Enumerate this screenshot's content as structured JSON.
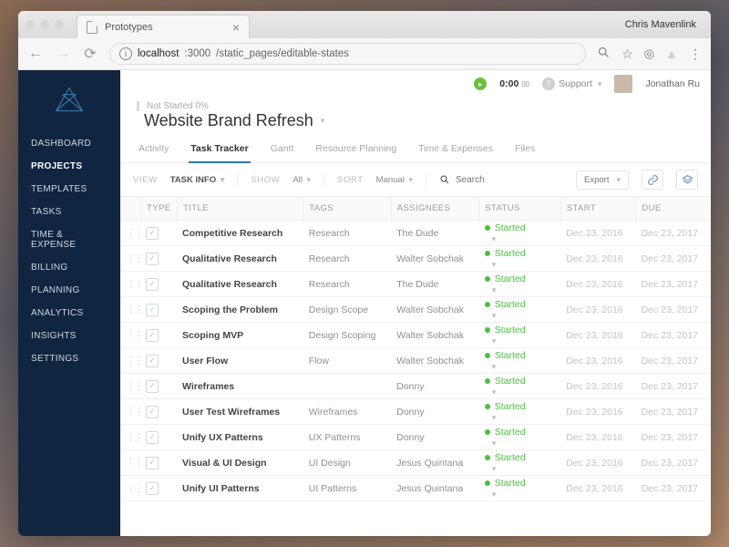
{
  "browser": {
    "tab_title": "Prototypes",
    "user_name": "Chris Mavenlink",
    "url_prefix": "localhost",
    "url_port": ":3000",
    "url_path": "/static_pages/editable-states"
  },
  "header": {
    "timer": "0:00",
    "timer_ms": "00",
    "support": "Support",
    "account_name": "Jonathan Ru"
  },
  "sidebar": {
    "items": [
      "DASHBOARD",
      "PROJECTS",
      "TEMPLATES",
      "TASKS",
      "TIME & EXPENSE",
      "BILLING",
      "PLANNING",
      "ANALYTICS",
      "INSIGHTS",
      "SETTINGS"
    ],
    "active_index": 1
  },
  "project": {
    "status": "Not Started 0%",
    "title": "Website Brand Refresh"
  },
  "tabs": {
    "items": [
      "Activity",
      "Task Tracker",
      "Gantt",
      "Resource Planning",
      "Time & Expenses",
      "Files"
    ],
    "active_index": 1
  },
  "toolbar": {
    "view_label": "VIEW",
    "view_value": "TASK INFO",
    "show_label": "SHOW",
    "show_value": "All",
    "sort_label": "SORT",
    "sort_value": "Manual",
    "search_placeholder": "Search",
    "export": "Export"
  },
  "columns": [
    "TYPE",
    "TITLE",
    "TAGS",
    "ASSIGNEES",
    "STATUS",
    "START",
    "DUE"
  ],
  "rows": [
    {
      "title": "Competitive Research",
      "tag": "Research",
      "assignee": "The Dude",
      "status": "Started",
      "start": "Dec 23, 2016",
      "due": "Dec 23, 2017"
    },
    {
      "title": "Qualitative Research",
      "tag": "Research",
      "assignee": "Walter Sobchak",
      "status": "Started",
      "start": "Dec 23, 2016",
      "due": "Dec 23, 2017"
    },
    {
      "title": "Qualitative Research",
      "tag": "Research",
      "assignee": "The Dude",
      "status": "Started",
      "start": "Dec 23, 2016",
      "due": "Dec 23, 2017"
    },
    {
      "title": "Scoping the Problem",
      "tag": "Design Scope",
      "assignee": "Walter Sobchak",
      "status": "Started",
      "start": "Dec 23, 2016",
      "due": "Dec 23, 2017"
    },
    {
      "title": "Scoping MVP",
      "tag": "Design Scoping",
      "assignee": "Walter Sobchak",
      "status": "Started",
      "start": "Dec 23, 2016",
      "due": "Dec 23, 2017"
    },
    {
      "title": "User Flow",
      "tag": "Flow",
      "assignee": "Walter Sobchak",
      "status": "Started",
      "start": "Dec 23, 2016",
      "due": "Dec 23, 2017"
    },
    {
      "title": "Wireframes",
      "tag": "",
      "assignee": "Donny",
      "status": "Started",
      "start": "Dec 23, 2016",
      "due": "Dec 23, 2017"
    },
    {
      "title": "User Test Wireframes",
      "tag": "Wireframes",
      "assignee": "Donny",
      "status": "Started",
      "start": "Dec 23, 2016",
      "due": "Dec 23, 2017"
    },
    {
      "title": "Unify UX Patterns",
      "tag": "UX Patterns",
      "assignee": "Donny",
      "status": "Started",
      "start": "Dec 23, 2016",
      "due": "Dec 23, 2017"
    },
    {
      "title": "Visual & UI Design",
      "tag": "UI Design",
      "assignee": "Jesus Quintana",
      "status": "Started",
      "start": "Dec 23, 2016",
      "due": "Dec 23, 2017"
    },
    {
      "title": "Unify UI Patterns",
      "tag": "UI Patterns",
      "assignee": "Jesus Quintana",
      "status": "Started",
      "start": "Dec 23, 2016",
      "due": "Dec 23, 2017"
    }
  ]
}
